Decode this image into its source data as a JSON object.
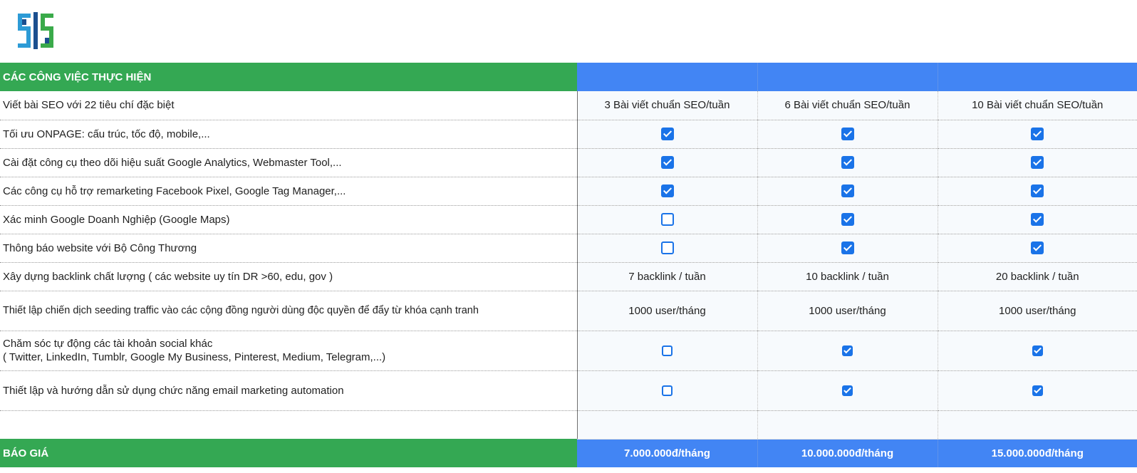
{
  "colors": {
    "header_green": "#34a853",
    "header_blue": "#4285f4",
    "checkbox_blue": "#1a73e8"
  },
  "logo": {
    "icon": "company-logo-icon"
  },
  "header": {
    "title": "CÁC CÔNG VIỆC THỰC HIỆN"
  },
  "rows": [
    {
      "task": "Viết bài SEO với 22 tiêu chí đặc biệt",
      "values": [
        "3 Bài viết chuẩn SEO/tuần",
        "6 Bài viết chuẩn SEO/tuần",
        "10 Bài viết chuẩn SEO/tuần"
      ]
    },
    {
      "task": "Tối ưu ONPAGE:  cấu trúc, tốc độ, mobile,...",
      "checks": [
        true,
        true,
        true
      ]
    },
    {
      "task": "Cài đặt công cụ theo dõi hiệu suất Google Analytics, Webmaster Tool,...",
      "checks": [
        true,
        true,
        true
      ]
    },
    {
      "task": "Các công cụ hỗ trợ remarketing Facebook Pixel, Google Tag Manager,...",
      "checks": [
        true,
        true,
        true
      ]
    },
    {
      "task": "Xác minh Google Doanh Nghiệp (Google Maps)",
      "checks": [
        false,
        true,
        true
      ]
    },
    {
      "task": "Thông báo website với Bộ Công Thương",
      "checks": [
        false,
        true,
        true
      ]
    },
    {
      "task": "Xây dựng backlink chất lượng ( các website uy tín DR >60, edu, gov )",
      "values": [
        "7 backlink / tuần",
        "10 backlink / tuần",
        "20 backlink / tuần"
      ]
    },
    {
      "task": "Thiết lập chiến dịch seeding traffic vào các cộng đồng người dùng độc quyền để đẩy từ khóa cạnh tranh",
      "values": [
        "1000 user/tháng",
        "1000 user/tháng",
        "1000 user/tháng"
      ]
    },
    {
      "task": "Chăm sóc tự động các tài khoản social khác",
      "task_line2": "( Twitter, LinkedIn, Tumblr, Google My Business, Pinterest, Medium, Telegram,...)",
      "checks": [
        false,
        true,
        true
      ]
    },
    {
      "task": "Thiết lập và hướng dẫn sử dụng chức năng email marketing automation",
      "checks": [
        false,
        true,
        true
      ]
    }
  ],
  "footer": {
    "label": "BÁO GIÁ",
    "prices": [
      "7.000.000đ/tháng",
      "10.000.000đ/tháng",
      "15.000.000đ/tháng"
    ]
  }
}
